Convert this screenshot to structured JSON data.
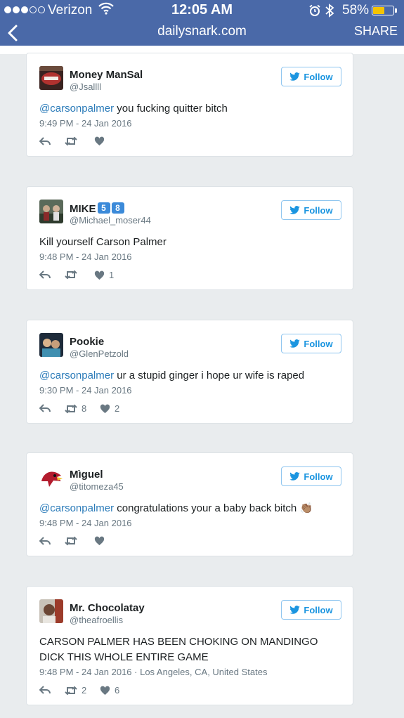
{
  "status_bar": {
    "carrier": "Verizon",
    "time": "12:05 AM",
    "battery_pct": "58%",
    "battery_level": 0.58,
    "signal_bars": 3
  },
  "nav": {
    "url": "dailysnark.com",
    "share_label": "SHARE"
  },
  "colors": {
    "bar": "#4a69a8",
    "twitter_blue": "#1b95e0",
    "mention": "#2b7bb9"
  },
  "tweets": [
    {
      "name": "Money ManSal",
      "handle": "@Jsallll",
      "follow_label": "Follow",
      "mention": "@carsonpalmer",
      "text": " you fucking quitter bitch",
      "timestamp": "9:49 PM - 24 Jan 2016",
      "retweets": "",
      "likes": ""
    },
    {
      "name": "MIKE",
      "badges": [
        "5",
        "8"
      ],
      "handle": "@Michael_moser44",
      "follow_label": "Follow",
      "mention": "",
      "text": "Kill yourself Carson Palmer",
      "timestamp": "9:48 PM - 24 Jan 2016",
      "retweets": "",
      "likes": "1"
    },
    {
      "name": "Pookie",
      "handle": "@GlenPetzold",
      "follow_label": "Follow",
      "mention": "@carsonpalmer",
      "text": " ur a stupid ginger i hope ur wife is raped",
      "timestamp": "9:30 PM - 24 Jan 2016",
      "retweets": "8",
      "likes": "2"
    },
    {
      "name": "Mìguel",
      "handle": "@titomeza45",
      "follow_label": "Follow",
      "mention": "@carsonpalmer",
      "text": " congratulations your a baby back bitch",
      "emoji": "👏🏽",
      "timestamp": "9:48 PM - 24 Jan 2016",
      "retweets": "",
      "likes": ""
    },
    {
      "name": "Mr. Chocolatay",
      "handle": "@theafroellis",
      "follow_label": "Follow",
      "mention": "",
      "text_line1": "CARSON PALMER HAS BEEN CHOKING ON MANDINGO",
      "text_line2": "DICK THIS WHOLE ENTIRE GAME",
      "timestamp": "9:48 PM - 24 Jan 2016 · Los Angeles, CA, United States",
      "retweets": "2",
      "likes": "6"
    }
  ]
}
